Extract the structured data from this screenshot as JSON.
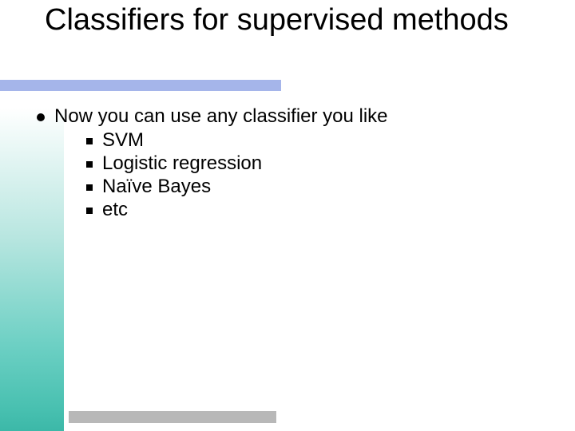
{
  "title": "Classifiers for supervised methods",
  "main_text": "Now you can use any classifier you like",
  "sub_items": [
    "SVM",
    "Logistic regression",
    "Naïve Bayes",
    "etc"
  ],
  "colors": {
    "accent_bar": "#a5b5ea",
    "bottom_bar": "#b8b8b8"
  }
}
